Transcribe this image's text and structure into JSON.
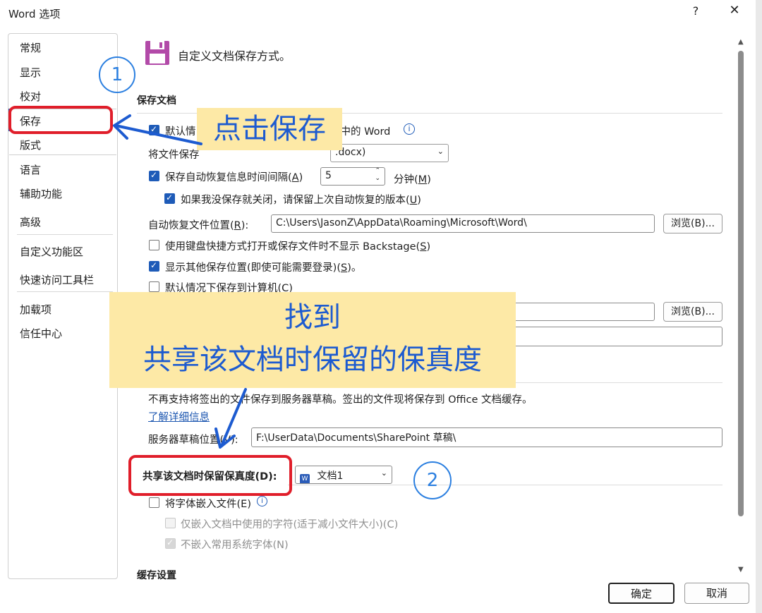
{
  "window": {
    "title": "Word 选项",
    "help": "?",
    "close": "✕"
  },
  "nav": {
    "items": [
      "常规",
      "显示",
      "校对",
      "保存",
      "版式",
      "语言",
      "辅助功能",
      "高级",
      "自定义功能区",
      "快速访问工具栏",
      "加载项",
      "信任中心"
    ],
    "selected": "保存"
  },
  "header": {
    "title": "自定义文档保存方式。"
  },
  "sections": {
    "save_docs": "保存文档",
    "cache": "缓存设置"
  },
  "rows": {
    "default_cloud": "默认情",
    "default_cloud_tail": "云中的 Word",
    "save_format_label": "将文件保存",
    "save_format_value": ".docx)",
    "autorecover": "保存自动恢复信息时间间隔(",
    "autorecover_key": "A",
    "autorecover_value": "5",
    "minutes": "分钟(",
    "minutes_key": "M",
    "keep_last": "如果我没保存就关闭，请保留上次自动恢复的版本(",
    "keep_last_key": "U",
    "autorecover_location_label": "自动恢复文件位置(",
    "autorecover_location_key": "R",
    "autorecover_location": "C:\\Users\\JasonZ\\AppData\\Roaming\\Microsoft\\Word\\",
    "browse1": "浏览(B)...",
    "no_backstage": "使用键盘快捷方式打开或保存文件时不显示 Backstage(",
    "no_backstage_key": "S",
    "show_other": "显示其他保存位置(即使可能需要登录)(",
    "show_other_key": "S",
    "save_local": "默认情况下保存到计算机(C)",
    "browse2": "浏览(B)...",
    "server_note": "不再支持将签出的文件保存到服务器草稿。签出的文件现将保存到 Office 文档缓存。",
    "learn_more": "了解详细信息",
    "server_drafts_label": "服务器草稿位置(V):",
    "server_drafts": "F:\\UserData\\Documents\\SharePoint 草稿\\",
    "fidelity_label": "共享该文档时保留保真度(D):",
    "fidelity_doc": "文档1",
    "embed_fonts": "将字体嵌入文件(E)",
    "embed_used_only": "仅嵌入文档中使用的字符(适于减小文件大小)(C)",
    "no_common_fonts": "不嵌入常用系统字体(N)"
  },
  "footer": {
    "ok": "确定",
    "cancel": "取消"
  },
  "annotations": {
    "click_save": "点击保存",
    "find_line1": "找到",
    "find_line2": "共享该文档时保留的保真度",
    "step1": "1",
    "step2": "2"
  },
  "colors": {
    "accent": "#1e5bb8",
    "annotation_bg": "#fde9a6",
    "annotation_text": "#1d5bd0",
    "red": "#e01e2a",
    "save_icon": "#b24aa8"
  }
}
